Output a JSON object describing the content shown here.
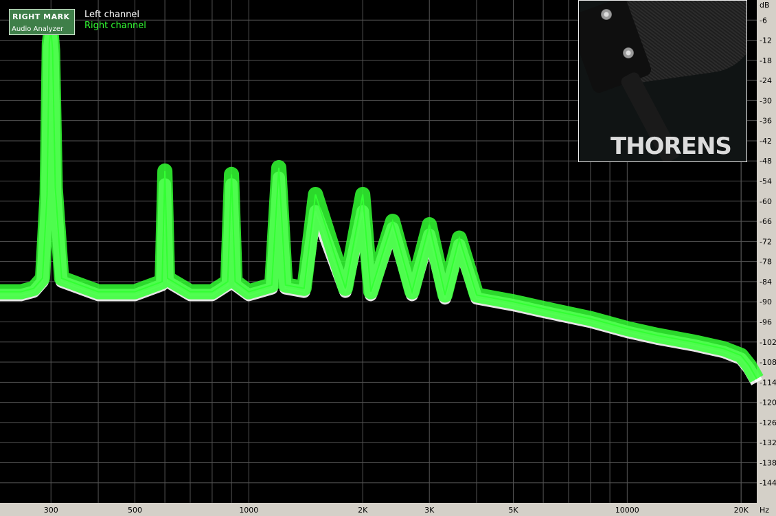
{
  "chart_data": {
    "type": "line",
    "xscale": "log",
    "xlim": [
      220,
      22000
    ],
    "ylim": [
      -150,
      0
    ],
    "xlabel": "Hz",
    "ylabel": "dB",
    "grid": true,
    "xticks": [
      300,
      500,
      1000,
      2000,
      3000,
      5000,
      10000,
      20000
    ],
    "xtick_labels": [
      "300",
      "500",
      "1000",
      "2K",
      "3K",
      "5K",
      "10000",
      "20K"
    ],
    "yticks": [
      -6,
      -12,
      -18,
      -24,
      -30,
      -36,
      -42,
      -48,
      -54,
      -60,
      -66,
      -72,
      -78,
      -84,
      -90,
      -96,
      -102,
      -108,
      -114,
      -120,
      -126,
      -132,
      -138,
      -144
    ],
    "series": [
      {
        "name": "Left channel",
        "color": "#ffffff",
        "x": [
          220,
          250,
          270,
          285,
          293,
          297,
          300,
          303,
          308,
          320,
          400,
          500,
          590,
          600,
          610,
          700,
          800,
          880,
          900,
          920,
          1000,
          1150,
          1200,
          1250,
          1400,
          1500,
          1800,
          2000,
          2100,
          2400,
          2700,
          3000,
          3300,
          3600,
          4000,
          5000,
          6000,
          8000,
          10000,
          12000,
          15000,
          18000,
          20000,
          21000,
          22000
        ],
        "y": [
          -88,
          -88,
          -87,
          -84,
          -60,
          -14,
          -10,
          -16,
          -58,
          -84,
          -88,
          -88,
          -85,
          -55,
          -84,
          -88,
          -88,
          -85,
          -55,
          -85,
          -88,
          -86,
          -53,
          -86,
          -87,
          -63,
          -87,
          -63,
          -88,
          -68,
          -88,
          -70,
          -89,
          -73,
          -89,
          -91,
          -93,
          -96,
          -99,
          -101,
          -103,
          -105,
          -107,
          -110,
          -114
        ]
      },
      {
        "name": "Right channel",
        "color": "#33ff33",
        "x": [
          220,
          250,
          270,
          285,
          293,
          297,
          300,
          303,
          308,
          320,
          400,
          500,
          590,
          600,
          610,
          700,
          800,
          880,
          900,
          920,
          1000,
          1150,
          1200,
          1250,
          1400,
          1500,
          1800,
          2000,
          2100,
          2400,
          2700,
          3000,
          3300,
          3600,
          4000,
          5000,
          6000,
          8000,
          10000,
          12000,
          15000,
          18000,
          20000,
          21000,
          22000
        ],
        "y": [
          -87,
          -87,
          -86,
          -83,
          -58,
          -13,
          -9,
          -15,
          -56,
          -83,
          -87,
          -87,
          -84,
          -51,
          -83,
          -87,
          -87,
          -84,
          -52,
          -84,
          -87,
          -85,
          -50,
          -85,
          -86,
          -58,
          -86,
          -58,
          -87,
          -66,
          -87,
          -67,
          -88,
          -71,
          -88,
          -90,
          -92,
          -95,
          -98,
          -100,
          -102,
          -104,
          -106,
          -109,
          -113
        ]
      }
    ],
    "legend_position": "top-left"
  },
  "logo": {
    "line1": "RIGHT MARK",
    "line2": "Audio Analyzer"
  },
  "legend": {
    "left": "Left channel",
    "right": "Right channel"
  },
  "inset": {
    "text": "THORENS"
  },
  "colors": {
    "background": "#000000",
    "grid": "#555555",
    "frame": "#d4d0c8",
    "axis_text": "#000000"
  }
}
